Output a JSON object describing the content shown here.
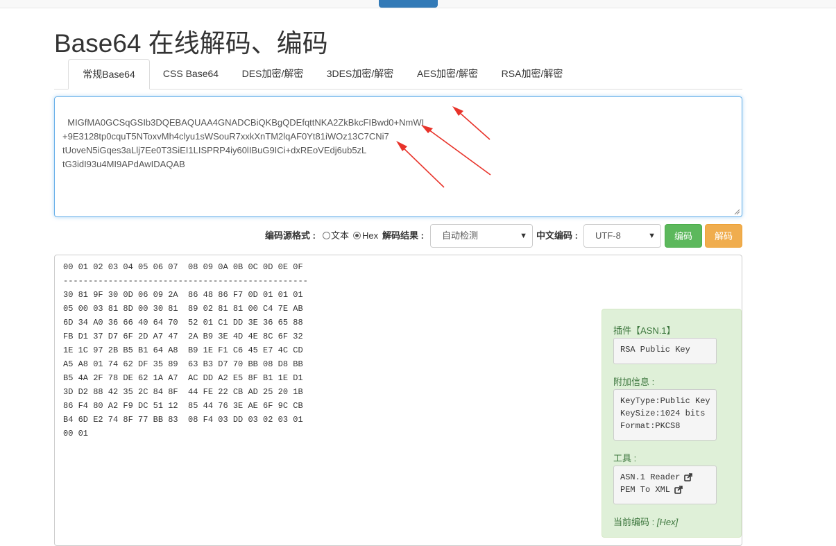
{
  "page": {
    "title": "Base64 在线解码、编码"
  },
  "tabs": [
    {
      "label": "常规Base64",
      "active": true
    },
    {
      "label": "CSS Base64",
      "active": false
    },
    {
      "label": "DES加密/解密",
      "active": false
    },
    {
      "label": "3DES加密/解密",
      "active": false
    },
    {
      "label": "AES加密/解密",
      "active": false
    },
    {
      "label": "RSA加密/解密",
      "active": false
    }
  ],
  "input": {
    "text": "MIGfMA0GCSqGSIb3DQEBAQUAA4GNADCBiQKBgQDEfqttNKA2ZkBkcFIBwd0+NmWI\n+9E3128tp0cquT5NToxvMh4clyu1sWSouR7xxkXnTM2lqAF0Yt81iWOz13C7CNi7\ntUoveN5iGqes3aLlj7Ee0T3SiEI1LISPRP4iy60lIBuG9ICi+dxREoVEdj6ub5zL\ntG3idI93u4MI9APdAwIDAQAB"
  },
  "controls": {
    "source_format_label": "编码源格式 :",
    "option_text": "文本",
    "option_hex": "Hex",
    "selected_format": "Hex",
    "result_label": "解码结果 :",
    "result_select_value": "自动检测",
    "charset_label": "中文编码 :",
    "charset_select_value": "UTF-8",
    "encode_button": "编码",
    "decode_button": "解码"
  },
  "output": {
    "header": "00 01 02 03 04 05 06 07  08 09 0A 0B 0C 0D 0E 0F",
    "separator": "-------------------------------------------------",
    "rows": [
      "30 81 9F 30 0D 06 09 2A  86 48 86 F7 0D 01 01 01",
      "05 00 03 81 8D 00 30 81  89 02 81 81 00 C4 7E AB",
      "6D 34 A0 36 66 40 64 70  52 01 C1 DD 3E 36 65 88",
      "FB D1 37 D7 6F 2D A7 47  2A B9 3E 4D 4E 8C 6F 32",
      "1E 1C 97 2B B5 B1 64 A8  B9 1E F1 C6 45 E7 4C CD",
      "A5 A8 01 74 62 DF 35 89  63 B3 D7 70 BB 08 D8 BB",
      "B5 4A 2F 78 DE 62 1A A7  AC DD A2 E5 8F B1 1E D1",
      "3D D2 88 42 35 2C 84 8F  44 FE 22 CB AD 25 20 1B",
      "86 F4 80 A2 F9 DC 51 12  85 44 76 3E AE 6F 9C CB",
      "B4 6D E2 74 8F 77 BB 83  08 F4 03 DD 03 02 03 01",
      "00 01"
    ]
  },
  "side_panel": {
    "plugin_label": "插件【ASN.1】",
    "plugin_value": "RSA Public Key",
    "extra_label": "附加信息 :",
    "extra_lines": [
      "KeyType:Public Key",
      "KeySize:1024 bits",
      "Format:PKCS8"
    ],
    "tools_label": "工具 :",
    "tools": [
      "ASN.1 Reader",
      "PEM To XML"
    ],
    "current_encoding_label": "当前编码 :",
    "current_encoding_value": "[Hex]"
  },
  "colors": {
    "annotation_arrow": "#e8332a",
    "encode_button": "#5cb85c",
    "decode_button": "#f0ad4e",
    "panel_background": "#dff0d8",
    "panel_text": "#3c763d"
  }
}
